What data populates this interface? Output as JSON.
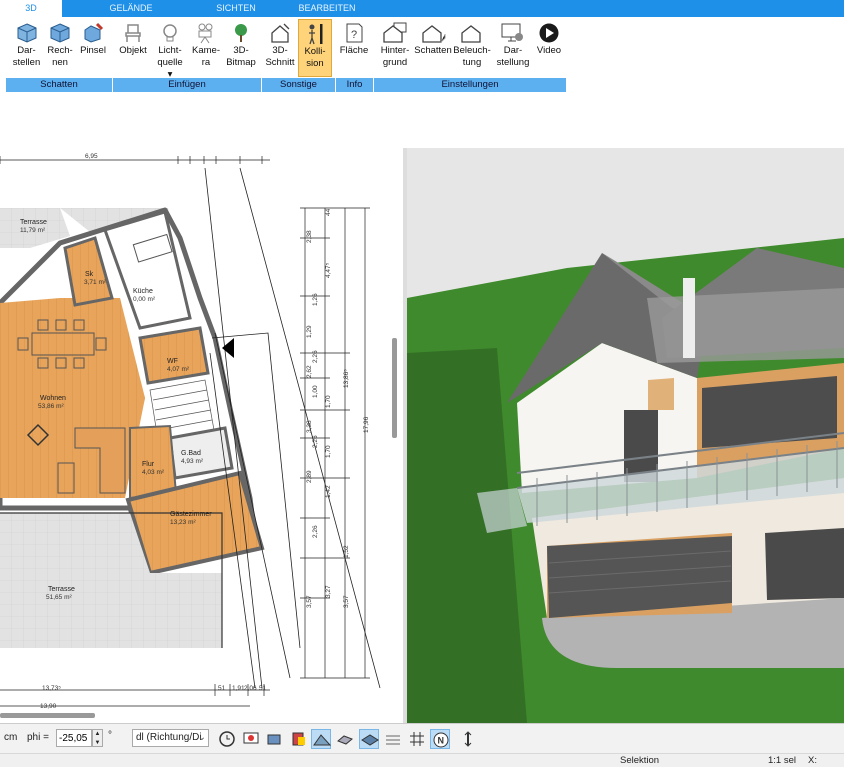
{
  "tabs": [
    {
      "label": "3D"
    },
    {
      "label": "GELÄNDE"
    },
    {
      "label": "SICHTEN"
    },
    {
      "label": "BEARBEITEN"
    }
  ],
  "ribbon": {
    "buttons": [
      {
        "l1": "Dar-",
        "l2": "stellen"
      },
      {
        "l1": "Rech-",
        "l2": "nen"
      },
      {
        "l1": "Pinsel",
        "l2": ""
      },
      {
        "l1": "Objekt",
        "l2": ""
      },
      {
        "l1": "Licht-",
        "l2": "quelle"
      },
      {
        "l1": "Kame-",
        "l2": "ra"
      },
      {
        "l1": "3D-",
        "l2": "Bitmap"
      },
      {
        "l1": "3D-",
        "l2": "Schnitt"
      },
      {
        "l1": "Kolli-",
        "l2": "sion"
      },
      {
        "l1": "Fläche",
        "l2": ""
      },
      {
        "l1": "Hinter-",
        "l2": "grund"
      },
      {
        "l1": "Schatten",
        "l2": ""
      },
      {
        "l1": "Beleuch-",
        "l2": "tung"
      },
      {
        "l1": "Dar-",
        "l2": "stellung"
      },
      {
        "l1": "Video",
        "l2": ""
      }
    ],
    "groups": [
      {
        "label": "Schatten"
      },
      {
        "label": "Einfügen"
      },
      {
        "label": "Sonstige"
      },
      {
        "label": "Info"
      },
      {
        "label": "Einstellungen"
      }
    ]
  },
  "plan": {
    "rooms": [
      {
        "name": "Terrasse",
        "area": "11,79 m²"
      },
      {
        "name": "Sk",
        "area": "3,71 m²"
      },
      {
        "name": "Küche",
        "area": "0,00 m²"
      },
      {
        "name": "WF",
        "area": "4,07 m²"
      },
      {
        "name": "Wohnen",
        "area": "53,86 m²"
      },
      {
        "name": "G.Bad",
        "area": "4,93 m²"
      },
      {
        "name": "Flur",
        "area": "4,03 m²"
      },
      {
        "name": "Gästezimmer",
        "area": "13,23 m²"
      },
      {
        "name": "Terrasse",
        "area": "51,65 m²"
      }
    ],
    "dims": {
      "top": "6,95",
      "bottom1": "13,73⁵",
      "bottom2": "13,90",
      "right_total": "17,96",
      "right_mid": "13,86⁵",
      "right_low": "3,57",
      "col1": [
        "44",
        "2,38",
        "4,47⁵",
        "1,26",
        "1,29",
        "2,26",
        "1,70",
        "2,89",
        "2,26",
        "1,52",
        "3,57"
      ],
      "col2": [
        "2,62",
        "2,26",
        "3,38",
        "1,00",
        "1,70",
        "1,42",
        "3,27"
      ],
      "bot": [
        "51",
        "1,91",
        "2,06",
        "51"
      ]
    }
  },
  "bottom": {
    "unit": "cm",
    "phi_label": "phi =",
    "phi_value": "-25,05",
    "deg": "°",
    "mode": "dl (Richtung/Di"
  },
  "status": {
    "mode": "Selektion",
    "sel": "1:1 sel",
    "x": "X:"
  }
}
